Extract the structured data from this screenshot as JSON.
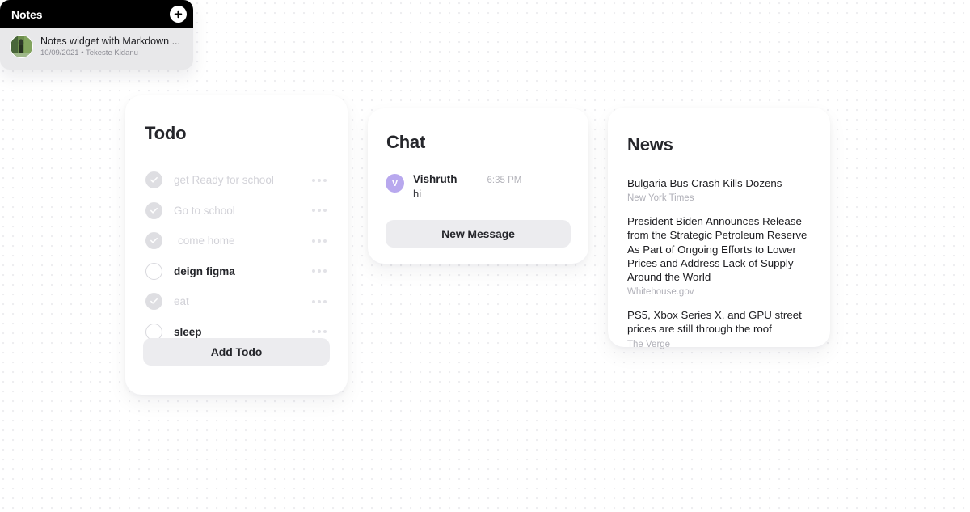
{
  "todo": {
    "title": "Todo",
    "items": [
      {
        "label": "get Ready for school",
        "done": true,
        "indent": false
      },
      {
        "label": "Go to school",
        "done": true,
        "indent": false
      },
      {
        "label": "come home",
        "done": true,
        "indent": true
      },
      {
        "label": "deign figma",
        "done": false,
        "indent": false
      },
      {
        "label": "eat",
        "done": true,
        "indent": false
      },
      {
        "label": "sleep",
        "done": false,
        "indent": false
      }
    ],
    "add_button": "Add Todo",
    "menu_icon": "ellipsis-icon",
    "check_icon": "check-icon"
  },
  "chat": {
    "title": "Chat",
    "message": {
      "avatar_initial": "V",
      "name": "Vishruth",
      "time": "6:35 PM",
      "text": "hi"
    },
    "new_message_button": "New Message"
  },
  "notes": {
    "title": "Notes",
    "add_icon": "plus-icon",
    "note": {
      "name": "Notes widget with Markdown ...",
      "date": "10/09/2021",
      "separator": "•",
      "author": "Tekeste Kidanu",
      "thumbnail": "photo-thumbnail"
    }
  },
  "news": {
    "title": "News",
    "stories": [
      {
        "headline": "Bulgaria Bus Crash Kills Dozens",
        "source": "New York Times"
      },
      {
        "headline": "President Biden Announces Release from the Strategic Petroleum Reserve As Part of Ongoing Efforts to Lower Prices and Address Lack of Supply Around the World",
        "source": "Whitehouse.gov"
      },
      {
        "headline": "PS5, Xbox Series X, and GPU street prices are still through the roof",
        "source": "The Verge"
      }
    ]
  },
  "colors": {
    "page_background": "#ffffff",
    "dot_grid": "#ededf0",
    "card_background": "#ffffff",
    "text_primary": "#25262b",
    "text_muted": "#b0b0b8",
    "done_text": "#d2d2d8",
    "pill_button": "#ececef",
    "avatar_purple": "#b8a8ee",
    "notes_header": "#000000",
    "notes_body": "#e8e8ea"
  }
}
